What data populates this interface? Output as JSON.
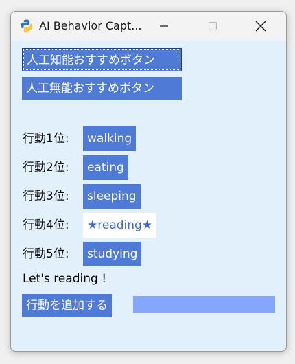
{
  "window": {
    "title": "AI Behavior Capt...",
    "background": "#e1f0fb"
  },
  "titlebar": {
    "app_icon": "python-icon",
    "minimize_icon": "minimize-icon",
    "maximize_icon": "maximize-icon",
    "close_icon": "close-icon"
  },
  "buttons": {
    "ai_recommend": "人工知能おすすめボタン",
    "non_ai_recommend": "人工無能おすすめボタン",
    "add_behavior": "行動を追加する"
  },
  "ranking": [
    {
      "label": "行動1位:",
      "value": "walking"
    },
    {
      "label": "行動2位:",
      "value": "eating"
    },
    {
      "label": "行動3位:",
      "value": "sleeping"
    },
    {
      "label": "行動4位:",
      "value": "★reading★"
    },
    {
      "label": "行動5位:",
      "value": "studying"
    }
  ],
  "message": "Let's reading !",
  "new_behavior_input": {
    "value": "",
    "color": "#85a6ff"
  },
  "colors": {
    "button": "#4f7bd6",
    "highlight_bg": "#ffffff",
    "highlight_text": "#3d6ad0"
  }
}
